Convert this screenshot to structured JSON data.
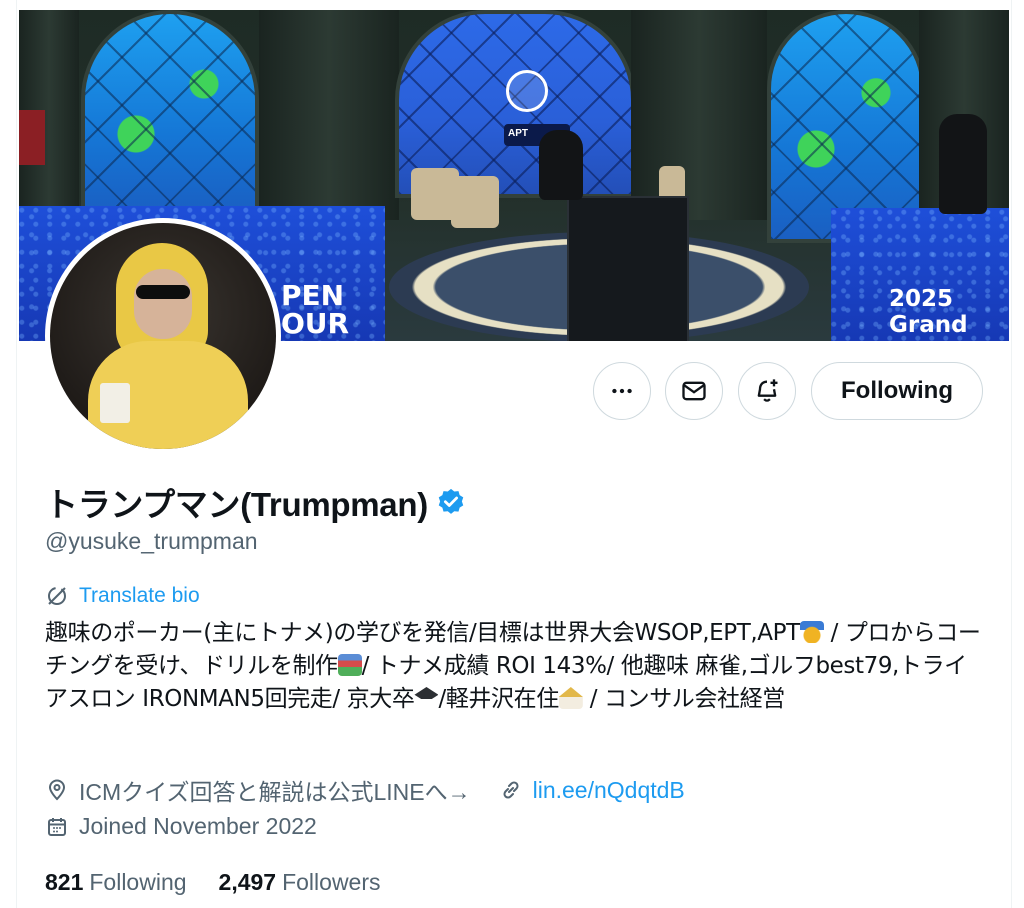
{
  "banner": {
    "wall_text_left_1": "PEN",
    "wall_text_left_2": "OUR",
    "wall_text_right": "2025 Grand",
    "badge_text": "APT"
  },
  "actions": {
    "more_icon": "more-horizontal-icon",
    "message_icon": "envelope-icon",
    "notify_icon": "bell-plus-icon",
    "follow_label": "Following"
  },
  "profile": {
    "display_name": "トランプマン(Trumpman)",
    "verified_icon": "verified-badge-icon",
    "handle": "@yusuke_trumpman",
    "translate_label": "Translate bio",
    "bio_segments": [
      "趣味のポーカー(主にトナメ)の学びを発信/目標は世界大会WSOP,EPT,APT",
      " / プロからコーチングを受け、ドリルを制作",
      "/ トナメ成績 ROI 143%/ 他趣味 麻雀,ゴルフbest79,トライアスロン IRONMAN5回完走/ 京大卒",
      "/軽井沢在住",
      " / コンサル会社経営"
    ],
    "location": "ICMクイズ回答と解説は公式LINEへ→",
    "url": "lin.ee/nQdqtdB",
    "joined": "Joined November 2022"
  },
  "stats": {
    "following_count": "821",
    "following_label": "Following",
    "followers_count": "2,497",
    "followers_label": "Followers"
  },
  "colors": {
    "accent": "#1d9bf0",
    "text_primary": "#0f1419",
    "text_secondary": "#536471",
    "border": "#cfd9de"
  }
}
